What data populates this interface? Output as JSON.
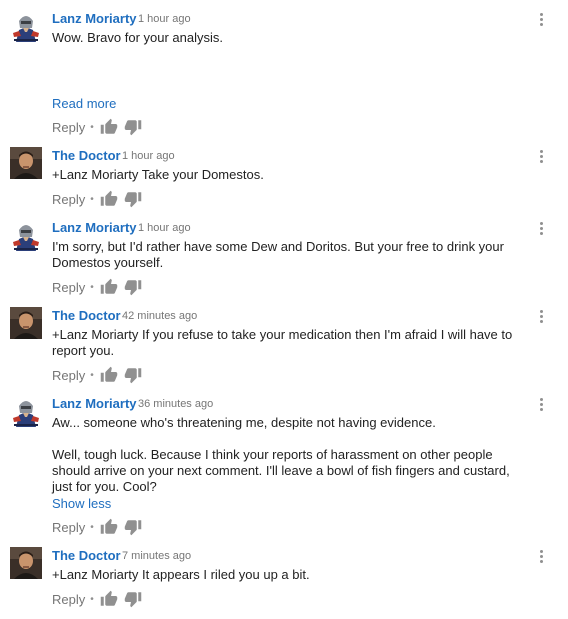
{
  "actions": {
    "reply_label": "Reply",
    "separator": "•"
  },
  "comments": [
    {
      "author": "Lanz Moriarty",
      "time": "1 hour ago",
      "avatar": "knight-avatar",
      "paragraphs": [
        "Wow. Bravo for your analysis."
      ],
      "toggle_label": "Read more"
    },
    {
      "author": "The Doctor",
      "time": "1 hour ago",
      "avatar": "photo-avatar",
      "paragraphs": [
        "+Lanz Moriarty Take your Domestos."
      ]
    },
    {
      "author": "Lanz Moriarty",
      "time": "1 hour ago",
      "avatar": "knight-avatar",
      "paragraphs": [
        "I'm sorry, but I'd rather have some Dew and Doritos. But your free to drink your Domestos yourself."
      ]
    },
    {
      "author": "The Doctor",
      "time": "42 minutes ago",
      "avatar": "photo-avatar",
      "paragraphs": [
        "+Lanz Moriarty If you refuse to take your medication then I'm afraid I will have to report you."
      ]
    },
    {
      "author": "Lanz Moriarty",
      "time": "36 minutes ago",
      "avatar": "knight-avatar",
      "paragraphs": [
        "Aw... someone who's threatening me, despite not having evidence.",
        "Well, tough luck. Because I think your reports of harassment on other people should arrive on your next comment. I'll leave a bowl of fish fingers and custard, just for you. Cool?"
      ],
      "toggle_label": "Show less"
    },
    {
      "author": "The Doctor",
      "time": "7 minutes ago",
      "avatar": "photo-avatar",
      "paragraphs": [
        "+Lanz Moriarty It appears I riled you up a bit."
      ]
    }
  ]
}
